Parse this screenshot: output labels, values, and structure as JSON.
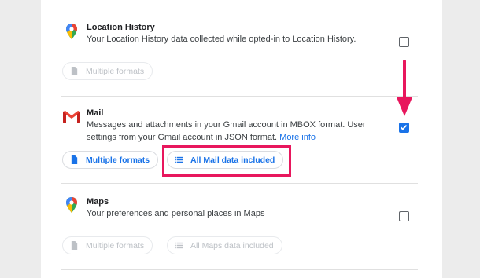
{
  "sections": [
    {
      "app": "location-history",
      "title": "Location History",
      "description": "Your Location History data collected while opted-in to Location History.",
      "checked": false,
      "chips": [
        {
          "label": "Multiple formats",
          "state": "disabled",
          "icon": "file-icon"
        }
      ]
    },
    {
      "app": "mail",
      "title": "Mail",
      "description": "Messages and attachments in your Gmail account in MBOX format. User settings from your Gmail account in JSON format.",
      "link": "More info",
      "checked": true,
      "chips": [
        {
          "label": "Multiple formats",
          "state": "active",
          "icon": "file-icon"
        },
        {
          "label": "All Mail data included",
          "state": "active",
          "icon": "list-icon"
        }
      ]
    },
    {
      "app": "maps",
      "title": "Maps",
      "description": "Your preferences and personal places in Maps",
      "checked": false,
      "chips": [
        {
          "label": "Multiple formats",
          "state": "disabled",
          "icon": "file-icon"
        },
        {
          "label": "All Maps data included",
          "state": "disabled",
          "icon": "list-icon"
        }
      ]
    }
  ],
  "annotation": {
    "arrow_color": "#e8175d",
    "highlight_color": "#e8175d"
  },
  "colors": {
    "accent": "#1a73e8",
    "disabled": "#bdc1c6"
  }
}
